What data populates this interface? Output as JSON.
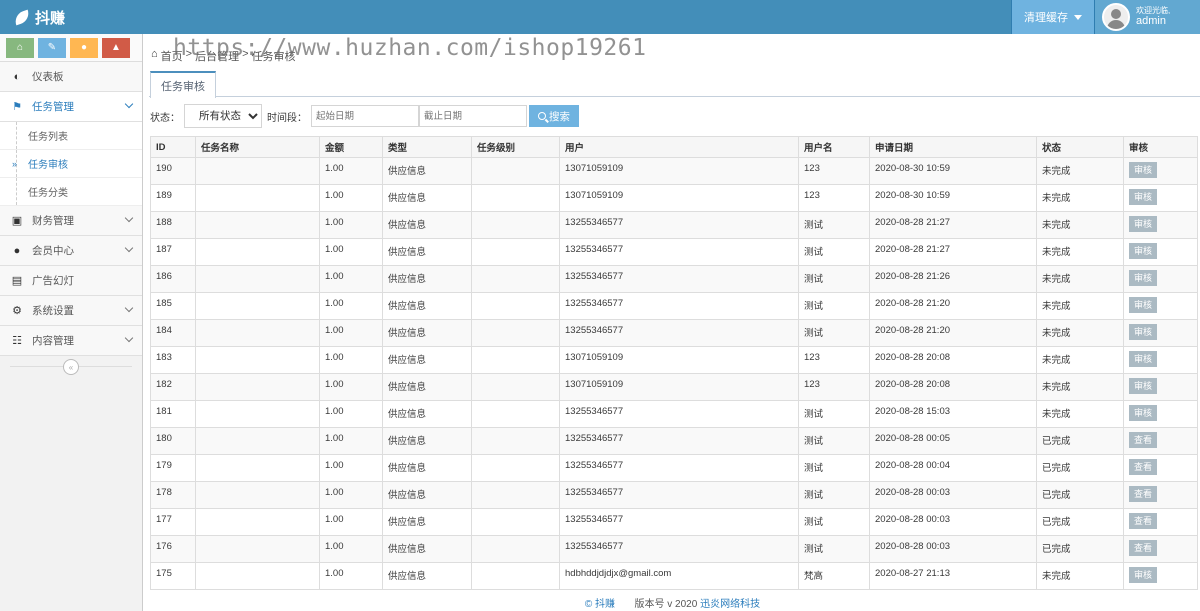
{
  "brand": {
    "title": "抖赚"
  },
  "header": {
    "cache_label": "清理缓存",
    "welcome": "欢迎光临,",
    "username": "admin"
  },
  "watermark": "https://www.huzhan.com/ishop19261",
  "sidebar": {
    "items": [
      {
        "label": "仪表板",
        "icon": "dashboard-icon"
      },
      {
        "label": "任务管理",
        "icon": "flag-icon"
      },
      {
        "label": "财务管理",
        "icon": "credit-card-icon"
      },
      {
        "label": "会员中心",
        "icon": "user-icon"
      },
      {
        "label": "广告幻灯",
        "icon": "picture-icon"
      },
      {
        "label": "系统设置",
        "icon": "cog-icon"
      },
      {
        "label": "内容管理",
        "icon": "book-icon"
      }
    ],
    "subitems": [
      "任务列表",
      "任务审核",
      "任务分类"
    ]
  },
  "breadcrumb": {
    "home": "首页",
    "section": "后台管理",
    "current": "任务审核"
  },
  "tab": {
    "label": "任务审核"
  },
  "filter": {
    "status_label": "状态：",
    "status_selected": "所有状态",
    "period_label": "时间段：",
    "start_placeholder": "起始日期",
    "end_placeholder": "截止日期",
    "search_label": "搜索"
  },
  "table": {
    "headers": [
      "ID",
      "任务名称",
      "金额",
      "类型",
      "任务级别",
      "用户",
      "用户名",
      "申请日期",
      "状态",
      "审核"
    ],
    "rows": [
      [
        "190",
        "",
        "1.00",
        "供应信息",
        "",
        "13071059109",
        "123",
        "2020-08-30 10:59",
        "未完成",
        "审核"
      ],
      [
        "189",
        "",
        "1.00",
        "供应信息",
        "",
        "13071059109",
        "123",
        "2020-08-30 10:59",
        "未完成",
        "审核"
      ],
      [
        "188",
        "",
        "1.00",
        "供应信息",
        "",
        "13255346577",
        "测试",
        "2020-08-28 21:27",
        "未完成",
        "审核"
      ],
      [
        "187",
        "",
        "1.00",
        "供应信息",
        "",
        "13255346577",
        "测试",
        "2020-08-28 21:27",
        "未完成",
        "审核"
      ],
      [
        "186",
        "",
        "1.00",
        "供应信息",
        "",
        "13255346577",
        "测试",
        "2020-08-28 21:26",
        "未完成",
        "审核"
      ],
      [
        "185",
        "",
        "1.00",
        "供应信息",
        "",
        "13255346577",
        "测试",
        "2020-08-28 21:20",
        "未完成",
        "审核"
      ],
      [
        "184",
        "",
        "1.00",
        "供应信息",
        "",
        "13255346577",
        "测试",
        "2020-08-28 21:20",
        "未完成",
        "审核"
      ],
      [
        "183",
        "",
        "1.00",
        "供应信息",
        "",
        "13071059109",
        "123",
        "2020-08-28 20:08",
        "未完成",
        "审核"
      ],
      [
        "182",
        "",
        "1.00",
        "供应信息",
        "",
        "13071059109",
        "123",
        "2020-08-28 20:08",
        "未完成",
        "审核"
      ],
      [
        "181",
        "",
        "1.00",
        "供应信息",
        "",
        "13255346577",
        "测试",
        "2020-08-28 15:03",
        "未完成",
        "审核"
      ],
      [
        "180",
        "",
        "1.00",
        "供应信息",
        "",
        "13255346577",
        "测试",
        "2020-08-28 00:05",
        "已完成",
        "查看"
      ],
      [
        "179",
        "",
        "1.00",
        "供应信息",
        "",
        "13255346577",
        "测试",
        "2020-08-28 00:04",
        "已完成",
        "查看"
      ],
      [
        "178",
        "",
        "1.00",
        "供应信息",
        "",
        "13255346577",
        "测试",
        "2020-08-28 00:03",
        "已完成",
        "查看"
      ],
      [
        "177",
        "",
        "1.00",
        "供应信息",
        "",
        "13255346577",
        "测试",
        "2020-08-28 00:03",
        "已完成",
        "查看"
      ],
      [
        "176",
        "",
        "1.00",
        "供应信息",
        "",
        "13255346577",
        "测试",
        "2020-08-28 00:03",
        "已完成",
        "查看"
      ],
      [
        "175",
        "",
        "1.00",
        "供应信息",
        "",
        "hdbhddjdjdjx@gmail.com",
        "梵高",
        "2020-08-27 21:13",
        "未完成",
        "审核"
      ]
    ]
  },
  "footer": {
    "copyright": "© 抖赚",
    "version_label": "版本号 v 2020",
    "company": "迅炎网络科技"
  },
  "colors": {
    "navbar": "#438eb9",
    "accent": "#2b7dbc",
    "search_button": "#6fb3e0",
    "action_button": "#abbac3"
  }
}
